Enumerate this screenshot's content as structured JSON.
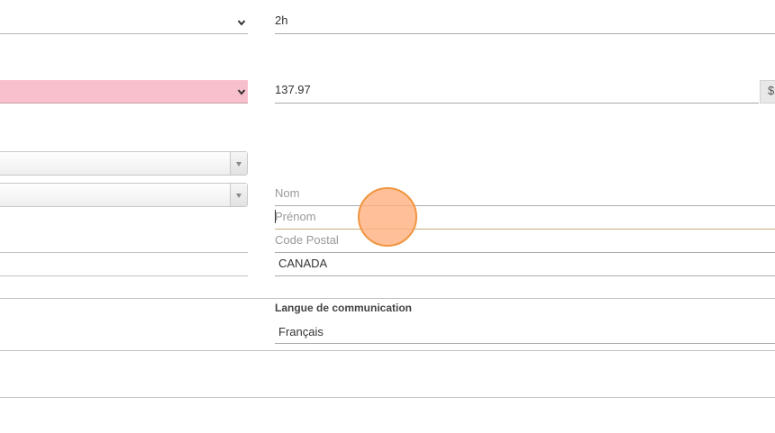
{
  "form": {
    "duration": {
      "value": "2h"
    },
    "amount": {
      "value": "137.97",
      "currency_symbol": "$"
    },
    "nom": {
      "placeholder": "Nom"
    },
    "prenom": {
      "placeholder": "Prénom"
    },
    "code_postal": {
      "placeholder": "Code Postal"
    },
    "country": {
      "value": "CANADA"
    },
    "language": {
      "label": "Langue de communication",
      "value": "Français"
    }
  },
  "icons": {
    "select_chevron": "chevron-down-icon",
    "combo_arrow": "triangle-down-icon"
  },
  "colors": {
    "invalid_select_bg": "#f8bfcc",
    "touch_indicator": "#ffb080",
    "touch_indicator_border": "#f0953f"
  }
}
